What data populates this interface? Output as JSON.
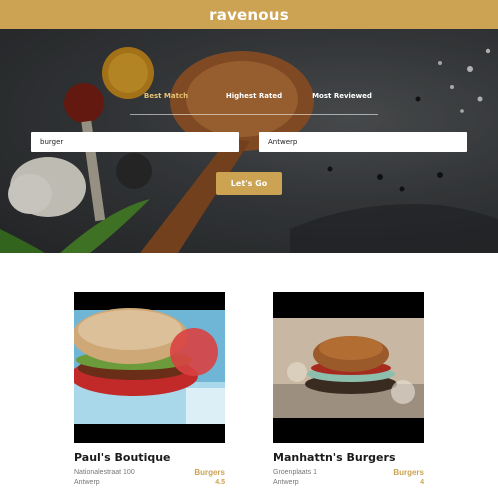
{
  "header": {
    "brand": "ravenous",
    "brand_color": "#cca353"
  },
  "search": {
    "sort_options": [
      {
        "label": "Best Match",
        "active": true
      },
      {
        "label": "Highest Rated",
        "active": false
      },
      {
        "label": "Most Reviewed",
        "active": false
      }
    ],
    "term_value": "burger",
    "location_value": "Antwerp",
    "submit_label": "Let's Go"
  },
  "businesses": [
    {
      "name": "Paul's Boutique",
      "address": "Nationalestraat 100",
      "city": "Antwerp",
      "category": "Burgers",
      "rating": "4.5"
    },
    {
      "name": "Manhattn's Burgers",
      "address": "Groenplaats 1",
      "city": "Antwerp",
      "category": "Burgers",
      "rating": "4"
    }
  ]
}
